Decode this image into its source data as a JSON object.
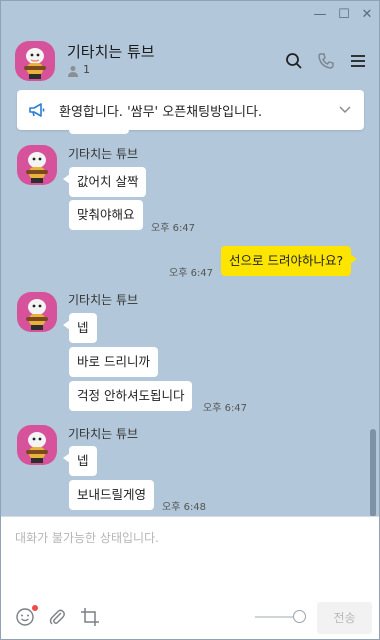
{
  "window": {
    "minimize_glyph": "—",
    "maximize_glyph": "☐",
    "close_glyph": "✕"
  },
  "header": {
    "title": "기타치는 튜브",
    "member_count": "1",
    "icons": [
      "search-icon",
      "phone-icon",
      "menu-icon"
    ]
  },
  "notice": {
    "text": "환영합니다. '쌈무' 오픈채팅방입니다.",
    "icon": "megaphone-icon"
  },
  "messages": {
    "group1": {
      "sender": "기타치는 튜브",
      "bubbles": [
        "값어치 살짝",
        "맞춰야해요"
      ],
      "time": "오후 6:47"
    },
    "mine": {
      "text": "선으로 드려야하나요?",
      "time": "오후 6:47"
    },
    "group2": {
      "sender": "기타치는 튜브",
      "bubbles": [
        "넵",
        "바로 드리니까",
        "걱정 안하셔도됩니다"
      ],
      "time": "오후 6:47"
    },
    "group3": {
      "sender": "기타치는 튜브",
      "bubbles": [
        "넵",
        "보내드릴게영"
      ],
      "time": "오후 6:48"
    }
  },
  "composer": {
    "placeholder": "대화가 불가능한 상태입니다.",
    "send_label": "전송",
    "icons": [
      "emoji-icon",
      "attach-icon",
      "crop-icon"
    ]
  },
  "colors": {
    "chat_background": "#b2c7d9",
    "my_bubble": "#fee500",
    "other_bubble": "#ffffff",
    "avatar_bg": "#d6529a",
    "notification_dot": "#f04a4a"
  }
}
